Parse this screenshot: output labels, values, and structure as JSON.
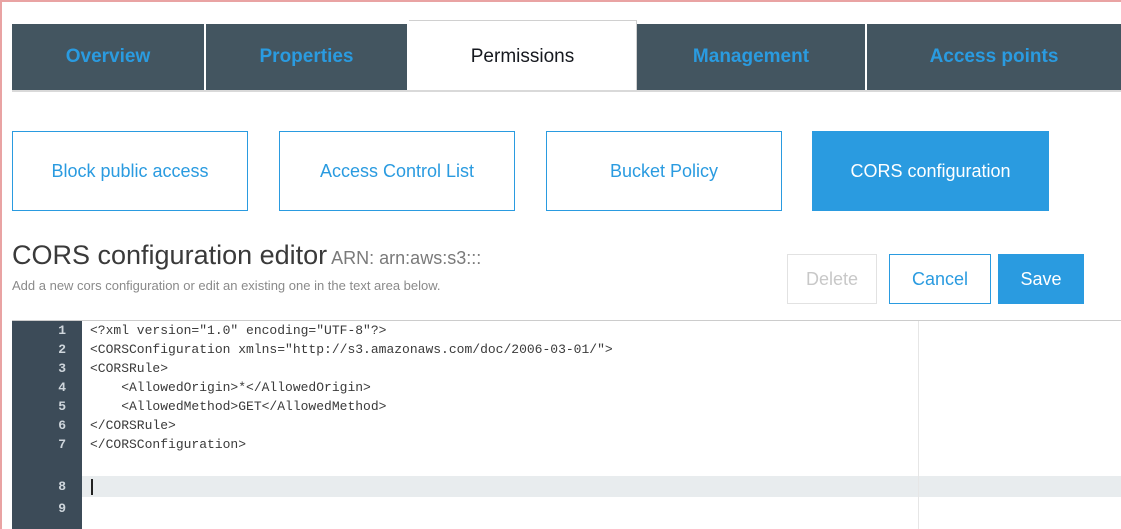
{
  "tabs": {
    "overview": "Overview",
    "properties": "Properties",
    "permissions": "Permissions",
    "management": "Management",
    "access_points": "Access points"
  },
  "subtabs": {
    "block_public_access": "Block public access",
    "acl": "Access Control List",
    "bucket_policy": "Bucket Policy",
    "cors": "CORS configuration"
  },
  "editor": {
    "title": "CORS configuration editor",
    "arn": "ARN: arn:aws:s3:::",
    "subtitle": "Add a new cors configuration or edit an existing one in the text area below.",
    "delete_label": "Delete",
    "cancel_label": "Cancel",
    "save_label": "Save",
    "line_numbers": [
      "1",
      "2",
      "3",
      "4",
      "5",
      "6",
      "7",
      "8",
      "9"
    ],
    "lines": [
      "<?xml version=\"1.0\" encoding=\"UTF-8\"?>",
      "<CORSConfiguration xmlns=\"http://s3.amazonaws.com/doc/2006-03-01/\">",
      "<CORSRule>",
      "    <AllowedOrigin>*</AllowedOrigin>",
      "    <AllowedMethod>GET</AllowedMethod>",
      "</CORSRule>",
      "</CORSConfiguration>",
      "",
      ""
    ]
  },
  "colors": {
    "tab_bg": "#435560",
    "accent": "#2a9be0",
    "gutter": "#3c4b58"
  }
}
